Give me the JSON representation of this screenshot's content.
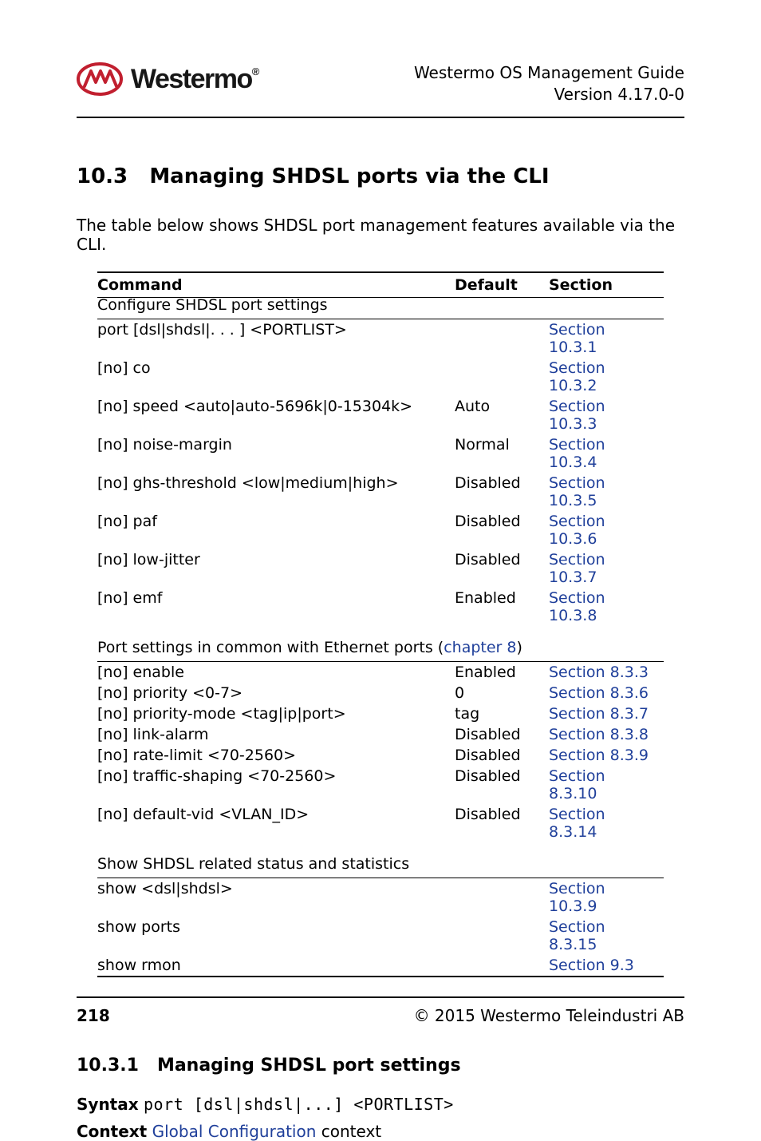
{
  "header": {
    "guide_title": "Westermo OS Management Guide",
    "version": "Version 4.17.0-0",
    "logo_brand": "Westermo",
    "logo_reg": "®"
  },
  "section": {
    "number": "10.3",
    "title": "Managing SHDSL ports via the CLI",
    "intro": "The table below shows SHDSL port management features available via the CLI."
  },
  "table": {
    "headers": {
      "command": "Command",
      "default": "Default",
      "section": "Section"
    },
    "group1_title": "Configure SHDSL port settings",
    "group1_rows": [
      {
        "cmd": "port [dsl|shdsl|. . . ] <PORTLIST>",
        "indent": 0,
        "default": "",
        "section": "Section 10.3.1"
      },
      {
        "cmd": "[no] co",
        "indent": 1,
        "default": "",
        "section": "Section 10.3.2"
      },
      {
        "cmd": "[no] speed <auto|auto-5696k|0-15304k>",
        "indent": 1,
        "default": "Auto",
        "section": "Section 10.3.3"
      },
      {
        "cmd": "[no] noise-margin",
        "indent": 1,
        "default": "Normal",
        "section": "Section 10.3.4"
      },
      {
        "cmd": "[no] ghs-threshold <low|medium|high>",
        "indent": 1,
        "default": "Disabled",
        "section": "Section 10.3.5"
      },
      {
        "cmd": "[no] paf",
        "indent": 1,
        "default": "Disabled",
        "section": "Section 10.3.6"
      },
      {
        "cmd": "[no] low-jitter",
        "indent": 1,
        "default": "Disabled",
        "section": "Section 10.3.7"
      },
      {
        "cmd": "[no] emf",
        "indent": 1,
        "default": "Enabled",
        "section": "Section 10.3.8"
      }
    ],
    "group2_title_pre": "Port settings in common with Ethernet ports (",
    "group2_title_link": "chapter 8",
    "group2_title_post": ")",
    "group2_rows": [
      {
        "cmd": "[no] enable",
        "indent": 1,
        "default": "Enabled",
        "section": "Section 8.3.3"
      },
      {
        "cmd": "[no] priority <0-7>",
        "indent": 1,
        "default": "0",
        "section": "Section 8.3.6"
      },
      {
        "cmd": "[no] priority-mode <tag|ip|port>",
        "indent": 1,
        "default": "tag",
        "section": "Section 8.3.7"
      },
      {
        "cmd": "[no] link-alarm",
        "indent": 1,
        "default": "Disabled",
        "section": "Section 8.3.8"
      },
      {
        "cmd": "[no] rate-limit <70-2560>",
        "indent": 1,
        "default": "Disabled",
        "section": "Section 8.3.9"
      },
      {
        "cmd": "[no] traffic-shaping <70-2560>",
        "indent": 1,
        "default": "Disabled",
        "section": "Section 8.3.10"
      },
      {
        "cmd": "[no] default-vid <VLAN_ID>",
        "indent": 1,
        "default": "Disabled",
        "section": "Section 8.3.14"
      }
    ],
    "group3_title": "Show SHDSL related status and statistics",
    "group3_rows": [
      {
        "cmd": "show <dsl|shdsl>",
        "indent": 0,
        "default": "",
        "section": "Section 10.3.9"
      },
      {
        "cmd": "show ports",
        "indent": 0,
        "default": "",
        "section": "Section 8.3.15"
      },
      {
        "cmd": "show rmon",
        "indent": 0,
        "default": "",
        "section": "Section 9.3"
      }
    ]
  },
  "subsection": {
    "number": "10.3.1",
    "title": "Managing SHDSL port settings",
    "syntax_label": "Syntax",
    "syntax_code": "port [dsl|shdsl|...] <PORTLIST>",
    "context_label": "Context",
    "context_link": "Global Configuration",
    "context_tail": " context"
  },
  "footer": {
    "page": "218",
    "copyright": "© 2015 Westermo Teleindustri AB"
  }
}
